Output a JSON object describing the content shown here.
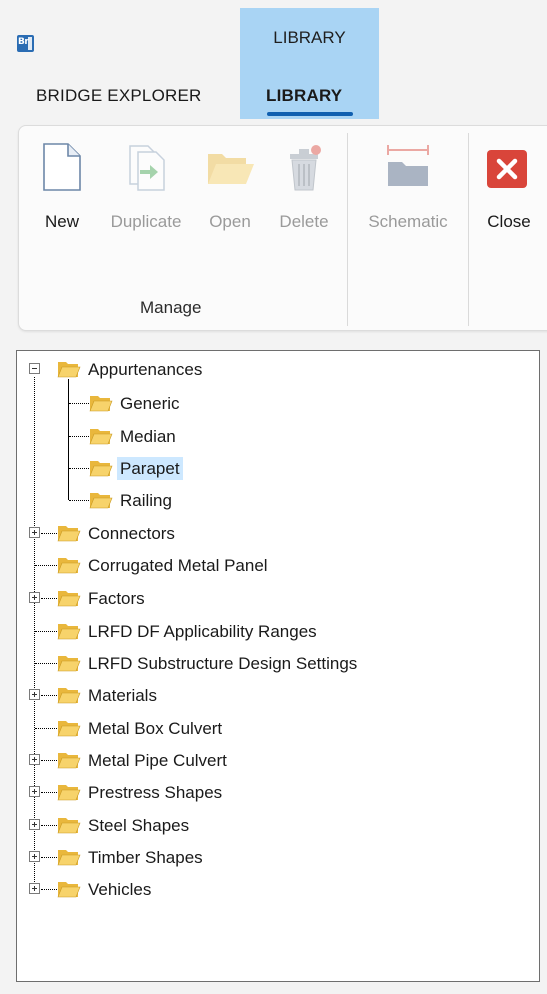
{
  "app": {
    "logo_text": "Br"
  },
  "ribbon_tabs": {
    "context_title": "LIBRARY",
    "bridge_explorer": "BRIDGE EXPLORER",
    "library": "LIBRARY"
  },
  "ribbon": {
    "buttons": {
      "new": "New",
      "duplicate": "Duplicate",
      "open": "Open",
      "delete": "Delete",
      "schematic": "Schematic",
      "close": "Close"
    },
    "group_label": "Manage"
  },
  "tree": {
    "appurtenances": "Appurtenances",
    "generic": "Generic",
    "median": "Median",
    "parapet": "Parapet",
    "railing": "Railing",
    "connectors": "Connectors",
    "corrugated_metal_panel": "Corrugated Metal Panel",
    "factors": "Factors",
    "lrfd_df": "LRFD DF Applicability Ranges",
    "lrfd_sub": "LRFD Substructure Design Settings",
    "materials": "Materials",
    "metal_box_culvert": "Metal Box Culvert",
    "metal_pipe_culvert": "Metal Pipe Culvert",
    "prestress_shapes": "Prestress Shapes",
    "steel_shapes": "Steel Shapes",
    "timber_shapes": "Timber Shapes",
    "vehicles": "Vehicles",
    "selected": "Parapet"
  },
  "colors": {
    "accent": "#0f5fb0",
    "context_tab": "#a9d4f4",
    "selection": "#cde8ff",
    "folder": "#f2c23c",
    "close_red": "#d9453a"
  }
}
